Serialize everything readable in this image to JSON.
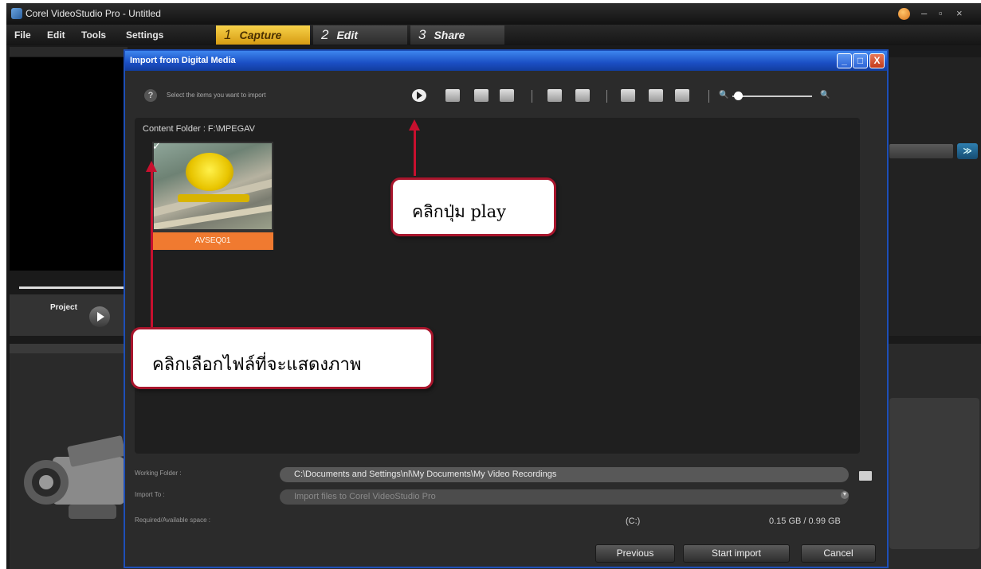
{
  "app": {
    "title": "Corel VideoStudio Pro - Untitled",
    "window_controls": [
      "–",
      "▫",
      "×"
    ],
    "menu": [
      "File",
      "Edit",
      "Tools",
      "Settings"
    ],
    "steps": [
      {
        "num": "1",
        "label": "Capture",
        "active": true
      },
      {
        "num": "2",
        "label": "Edit",
        "active": false
      },
      {
        "num": "3",
        "label": "Share",
        "active": false
      }
    ],
    "project_label": "Project",
    "expand_icon": "≫"
  },
  "dialog": {
    "title": "Import from Digital Media",
    "controls": {
      "minimize": "_",
      "maximize": "□",
      "close": "X"
    },
    "hint_icon": "?",
    "hint": "Select the items you want to import",
    "content_folder": "Content Folder : F:\\MPEGAV",
    "thumbnail": {
      "label": "AVSEQ01",
      "checked": true,
      "check_glyph": "✓"
    },
    "zoom": {
      "small": "🔍",
      "large": "🔍"
    },
    "working_folder": {
      "label": "Working Folder :",
      "value": "C:\\Documents and Settings\\nl\\My Documents\\My Video Recordings"
    },
    "import_to": {
      "label": "Import To :",
      "value": "Import files to Corel VideoStudio Pro"
    },
    "required_space": {
      "label": "Required/Available space :",
      "drive": "(C:)",
      "value": "0.15 GB / 0.99 GB"
    },
    "buttons": {
      "previous": "Previous",
      "start_import": "Start import",
      "cancel": "Cancel"
    }
  },
  "annotations": {
    "play_callout": "คลิกปุ่ม play",
    "file_callout": "คลิกเลือกไฟล์ที่จะแสดงภาพ",
    "color": "#c8102e"
  }
}
